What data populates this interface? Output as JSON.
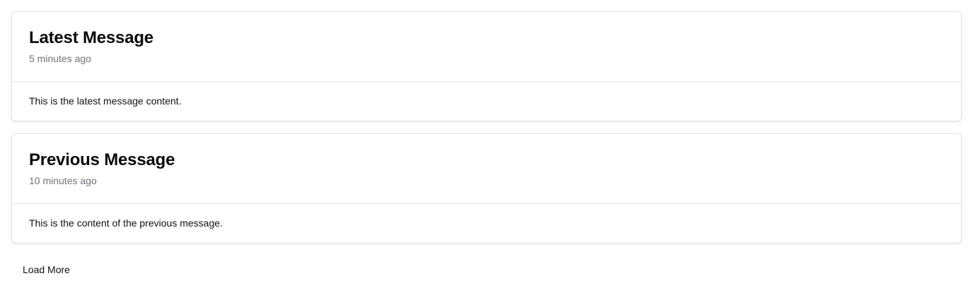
{
  "messages": [
    {
      "title": "Latest Message",
      "time": "5 minutes ago",
      "content": "This is the latest message content."
    },
    {
      "title": "Previous Message",
      "time": "10 minutes ago",
      "content": "This is the content of the previous message."
    }
  ],
  "load_more_label": "Load More",
  "colors": {
    "border": "#e4e4e7",
    "muted_text": "#71717a",
    "text": "#111111",
    "background": "#ffffff"
  }
}
